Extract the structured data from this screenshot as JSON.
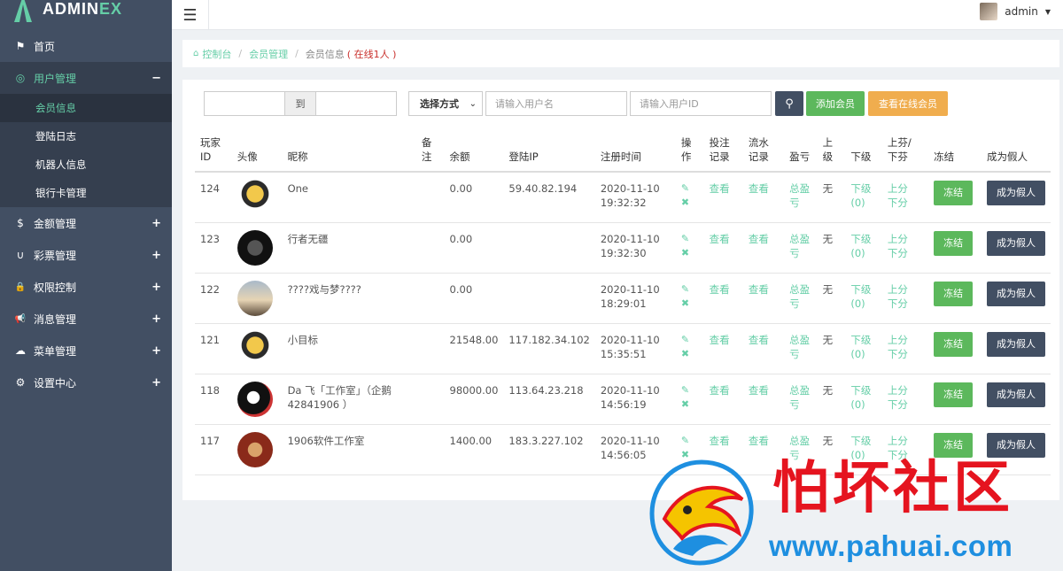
{
  "brand": {
    "name_a": "ADMIN",
    "name_b": "EX"
  },
  "header": {
    "user_name": "admin"
  },
  "sidebar": {
    "items": [
      {
        "label": "首页",
        "icon": "flag-icon",
        "glyph": "⚑",
        "toggle": ""
      },
      {
        "label": "用户管理",
        "icon": "palette-icon",
        "glyph": "◎",
        "toggle": "−"
      },
      {
        "label": "金额管理",
        "icon": "dollar-icon",
        "glyph": "$",
        "toggle": "+"
      },
      {
        "label": "彩票管理",
        "icon": "magnet-icon",
        "glyph": "∪",
        "toggle": "+"
      },
      {
        "label": "权限控制",
        "icon": "lock-icon",
        "glyph": "🔒",
        "toggle": "+"
      },
      {
        "label": "消息管理",
        "icon": "bullhorn-icon",
        "glyph": "📢",
        "toggle": "+"
      },
      {
        "label": "菜单管理",
        "icon": "cloud-icon",
        "glyph": "☁",
        "toggle": "+"
      },
      {
        "label": "设置中心",
        "icon": "gear-icon",
        "glyph": "⚙",
        "toggle": "+"
      }
    ],
    "sub_items": [
      "会员信息",
      "登陆日志",
      "机器人信息",
      "银行卡管理"
    ]
  },
  "breadcrumb": {
    "home": "控制台",
    "section": "会员管理",
    "current": "会员信息",
    "online": "( 在线1人 )"
  },
  "toolbar": {
    "date_to": "到",
    "method_select": "选择方式",
    "username_placeholder": "请输入用户名",
    "userid_placeholder": "请输入用户ID",
    "add_member": "添加会员",
    "view_online": "查看在线会员"
  },
  "table": {
    "headers": {
      "id": [
        "玩家",
        "ID"
      ],
      "avatar": "头像",
      "nickname": "昵称",
      "note": [
        "备",
        "注"
      ],
      "balance": "余额",
      "ip": "登陆IP",
      "reg_time": "注册时间",
      "op": [
        "操",
        "作"
      ],
      "bet": [
        "投注",
        "记录"
      ],
      "flow": [
        "流水",
        "记录"
      ],
      "profit": "盈亏",
      "upper": [
        "上",
        "级"
      ],
      "lower": "下级",
      "updown": [
        "上芬/",
        "下芬"
      ],
      "freeze": "冻结",
      "fake": "成为假人"
    },
    "actions": {
      "view": "查看",
      "profit": [
        "总盈",
        "亏"
      ],
      "upper_none": "无",
      "lower": [
        "下级",
        "(0)"
      ],
      "updown": [
        "上分",
        "下分"
      ],
      "freeze_btn": "冻结",
      "fake_btn": "成为假人"
    },
    "rows": [
      {
        "id": "124",
        "nickname": "One",
        "balance": "0.00",
        "ip": "59.40.82.194",
        "date": "2020-11-10",
        "time": "19:32:32"
      },
      {
        "id": "123",
        "nickname": "行者无疆",
        "balance": "0.00",
        "ip": "",
        "date": "2020-11-10",
        "time": "19:32:30"
      },
      {
        "id": "122",
        "nickname": "????戏与梦????",
        "balance": "0.00",
        "ip": "",
        "date": "2020-11-10",
        "time": "18:29:01"
      },
      {
        "id": "121",
        "nickname": "小目标",
        "balance": "21548.00",
        "ip": "117.182.34.102",
        "date": "2020-11-10",
        "time": "15:35:51"
      },
      {
        "id": "118",
        "nickname": "Da 飞「工作室」（企鹅 42841906 ）",
        "balance": "98000.00",
        "ip": "113.64.23.218",
        "date": "2020-11-10",
        "time": "14:56:19"
      },
      {
        "id": "117",
        "nickname": "1906软件工作室",
        "balance": "1400.00",
        "ip": "183.3.227.102",
        "date": "2020-11-10",
        "time": "14:56:05"
      }
    ]
  },
  "watermark": {
    "title": "怕坏社区",
    "url": "www.pahuai.com"
  },
  "colors": {
    "accent": "#65cea7",
    "sidebar": "#424f63",
    "danger": "#e5141f",
    "link_blue": "#1e8fe0"
  }
}
